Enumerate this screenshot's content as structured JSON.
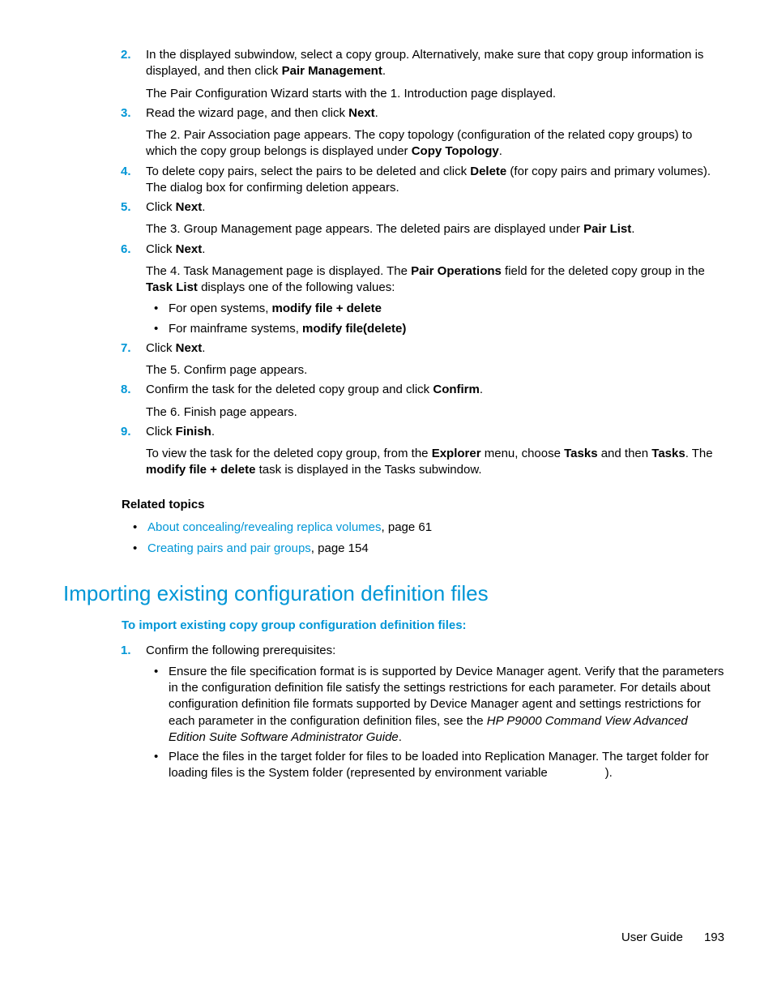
{
  "steps_a": {
    "2": {
      "main_before": "In the displayed subwindow, select a copy group. Alternatively, make sure that copy group information is displayed, and then click ",
      "main_bold": "Pair Management",
      "main_after": ".",
      "para": "The Pair Configuration Wizard starts with the 1. Introduction page displayed."
    },
    "3": {
      "main_before": "Read the wizard page, and then click ",
      "main_bold": "Next",
      "main_after": ".",
      "para_before": "The 2. Pair Association page appears. The copy topology (configuration of the related copy groups) to which the copy group belongs is displayed under ",
      "para_bold": "Copy Topology",
      "para_after": "."
    },
    "4": {
      "main_before": "To delete copy pairs, select the pairs to be deleted and click ",
      "main_bold": "Delete",
      "main_after": " (for copy pairs and primary volumes). The dialog box for confirming deletion appears."
    },
    "5": {
      "main_before": "Click ",
      "main_bold": "Next",
      "main_after": ".",
      "para_before": "The 3. Group Management page appears. The deleted pairs are displayed under ",
      "para_bold": "Pair List",
      "para_after": "."
    },
    "6": {
      "main_before": "Click ",
      "main_bold": "Next",
      "main_after": ".",
      "para_a": "The 4. Task Management page is displayed. The ",
      "para_b_bold": "Pair Operations",
      "para_c": " field for the deleted copy group in the ",
      "para_d_bold": "Task List",
      "para_e": " displays one of the following values:",
      "bullet1_before": "For open systems, ",
      "bullet1_bold": "modify file + delete",
      "bullet2_before": "For mainframe systems, ",
      "bullet2_bold": "modify file(delete)"
    },
    "7": {
      "main_before": "Click ",
      "main_bold": "Next",
      "main_after": ".",
      "para": "The 5. Confirm page appears."
    },
    "8": {
      "main_before": "Confirm the task for the deleted copy group and click ",
      "main_bold": "Confirm",
      "main_after": ".",
      "para": "The 6. Finish page appears."
    },
    "9": {
      "main_before": "Click ",
      "main_bold": "Finish",
      "main_after": ".",
      "para_a": "To view the task for the deleted copy group, from the ",
      "para_b_bold": "Explorer",
      "para_c": " menu, choose ",
      "para_d_bold": "Tasks",
      "para_e": " and then ",
      "para_f_bold": "Tasks",
      "para_g": ". The ",
      "para_h_bold": "modify file + delete",
      "para_i": "  task is displayed in the Tasks subwindow."
    }
  },
  "related_topics_heading": "Related topics",
  "related": {
    "0": {
      "link": "About concealing/revealing replica volumes",
      "suffix": ", page 61"
    },
    "1": {
      "link": "Creating pairs and pair groups",
      "suffix": ", page 154"
    }
  },
  "section_title": "Importing existing configuration definition files",
  "procedure_lead": "To import existing copy group configuration definition files:",
  "steps_b": {
    "1": {
      "main": "Confirm the following prerequisites:",
      "bullet1_before": "Ensure the file specification format is is supported by Device Manager agent. Verify that the parameters in the configuration definition file satisfy the settings restrictions for each parameter. For details about configuration definition file formats supported by Device Manager agent and settings restrictions for each parameter in the configuration definition files, see the ",
      "bullet1_italic": "HP P9000 Command View Advanced Edition Suite Software Administrator Guide",
      "bullet1_after": ".",
      "bullet2": "Place the files in the target folder for files to be loaded into Replication Manager. The target folder for loading files is the System folder (represented by environment variable",
      "bullet2_after": ")."
    }
  },
  "footer": {
    "label": "User Guide",
    "page": "193"
  }
}
